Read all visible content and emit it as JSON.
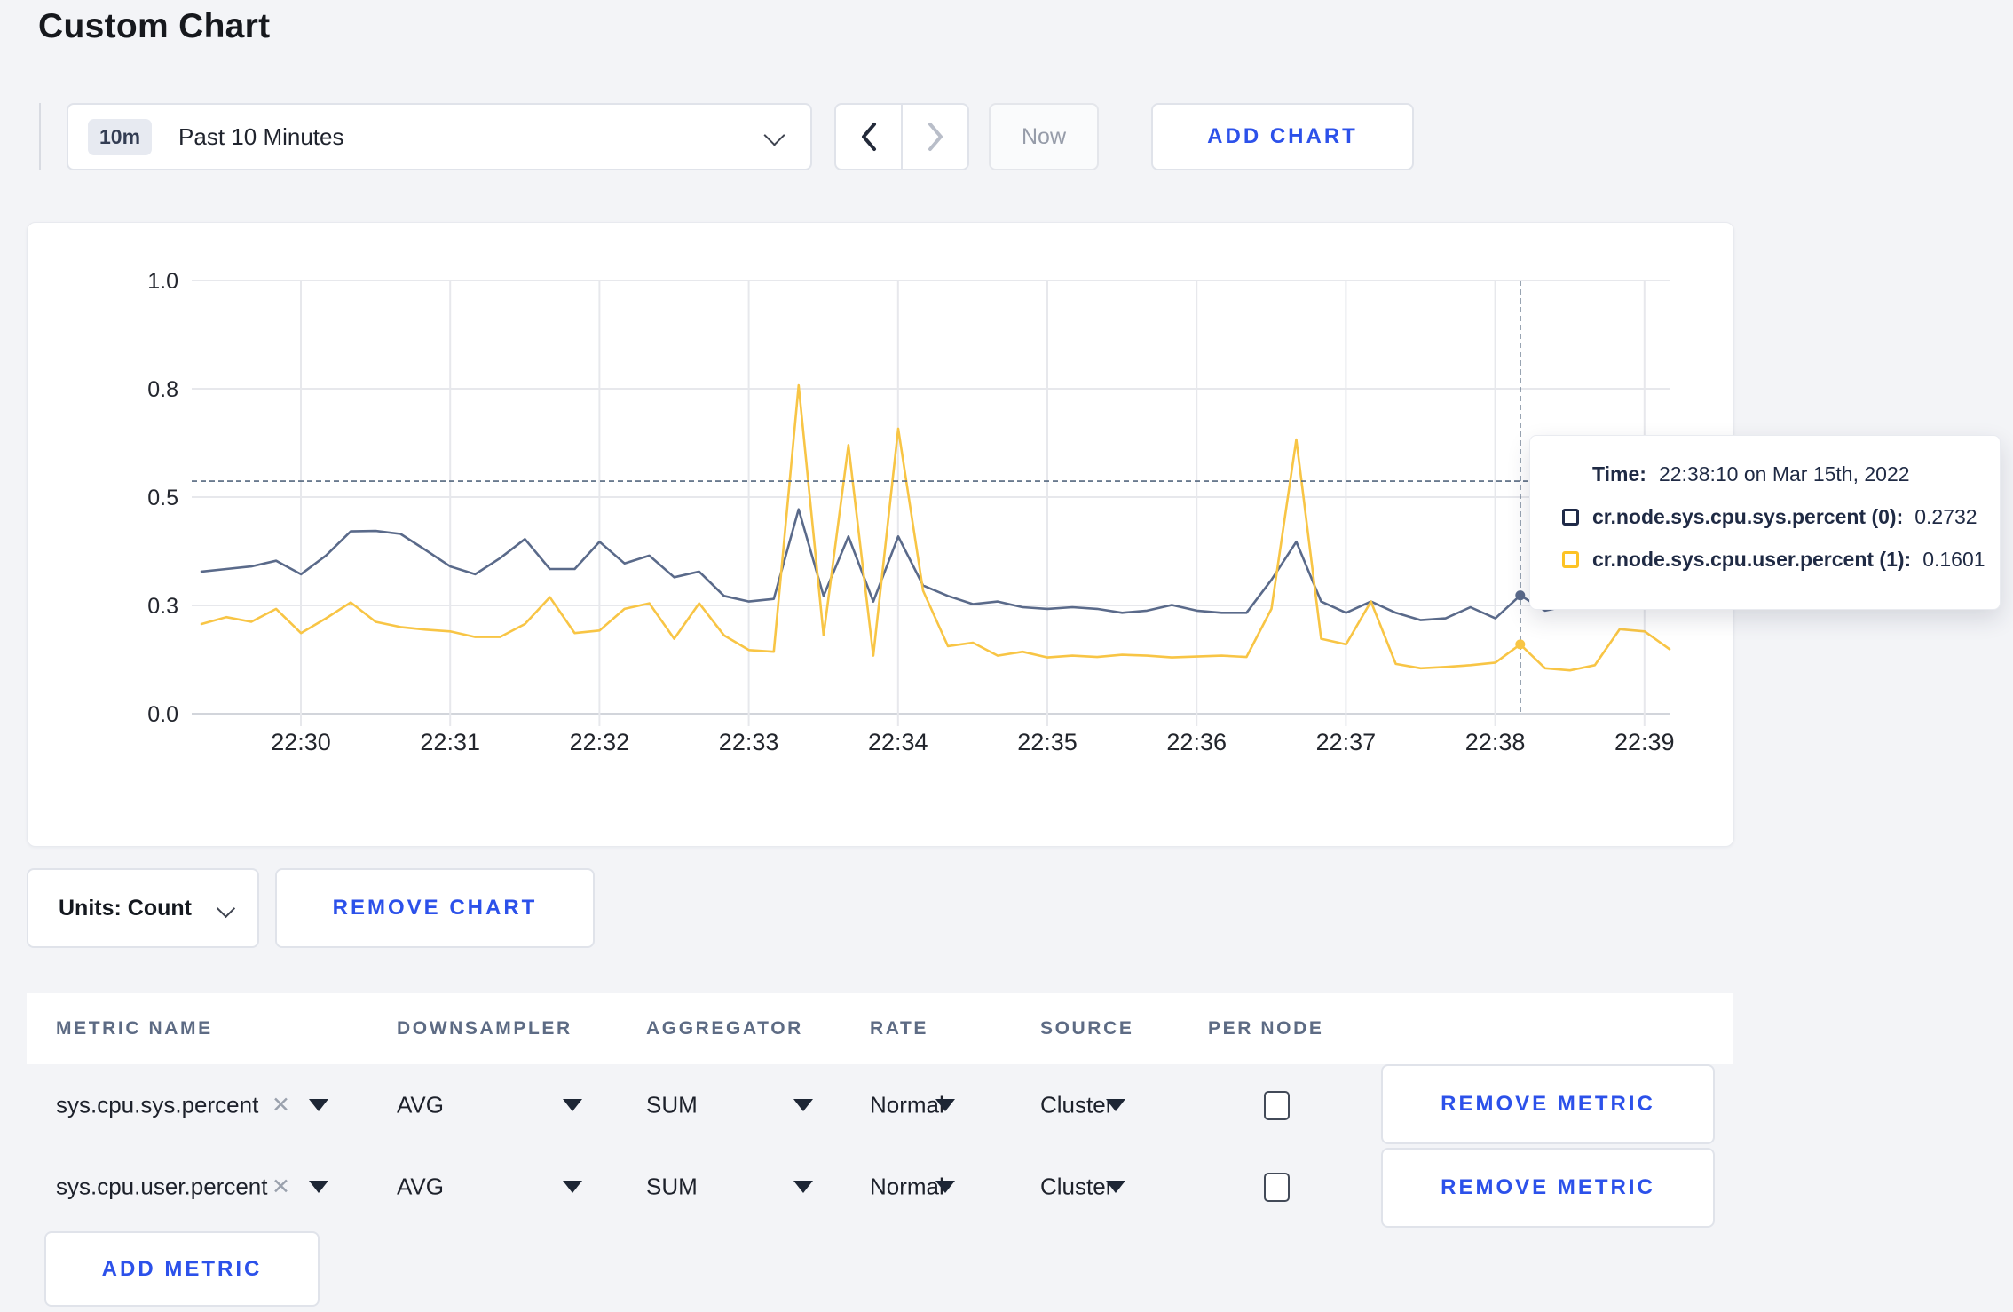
{
  "page": {
    "title": "Custom Chart",
    "background": "#f3f4f7",
    "accent_blue": "#2c51ea"
  },
  "toolbar": {
    "time_badge": "10m",
    "time_label": "Past 10 Minutes",
    "prev_icon": "chevron-left",
    "next_icon": "chevron-right",
    "now_label": "Now",
    "add_chart_label": "ADD CHART"
  },
  "chart_data": {
    "type": "line",
    "title": "",
    "xlabel": "",
    "ylabel": "",
    "ylim": [
      0,
      1
    ],
    "grid": true,
    "start_time": "22:29:20",
    "interval_seconds": 10,
    "xticks": [
      "22:30",
      "22:31",
      "22:32",
      "22:33",
      "22:34",
      "22:35",
      "22:36",
      "22:37",
      "22:38",
      "22:39"
    ],
    "yticks": [
      {
        "v": 0,
        "label": "0.0"
      },
      {
        "v": 0.25,
        "label": "0.3"
      },
      {
        "v": 0.5,
        "label": "0.5"
      },
      {
        "v": 0.75,
        "label": "0.8"
      },
      {
        "v": 1,
        "label": "1.0"
      }
    ],
    "series": [
      {
        "name": "cr.node.sys.cpu.sys.percent",
        "color": "#5a6a8a",
        "values": [
          0.328,
          0.334,
          0.34,
          0.353,
          0.322,
          0.365,
          0.421,
          0.422,
          0.415,
          0.378,
          0.34,
          0.322,
          0.359,
          0.403,
          0.334,
          0.334,
          0.397,
          0.347,
          0.365,
          0.315,
          0.328,
          0.272,
          0.259,
          0.265,
          0.472,
          0.272,
          0.409,
          0.259,
          0.409,
          0.296,
          0.272,
          0.253,
          0.259,
          0.246,
          0.242,
          0.246,
          0.242,
          0.233,
          0.238,
          0.251,
          0.238,
          0.233,
          0.233,
          0.309,
          0.397,
          0.259,
          0.233,
          0.259,
          0.233,
          0.216,
          0.22,
          0.246,
          0.22,
          0.2732,
          0.238,
          0.25,
          0.262,
          0.272,
          0.28,
          0.285
        ]
      },
      {
        "name": "cr.node.sys.cpu.user.percent",
        "color": "#f8c545",
        "values": [
          0.207,
          0.223,
          0.212,
          0.242,
          0.186,
          0.22,
          0.257,
          0.212,
          0.2,
          0.194,
          0.19,
          0.177,
          0.177,
          0.207,
          0.269,
          0.186,
          0.192,
          0.242,
          0.255,
          0.173,
          0.255,
          0.181,
          0.147,
          0.143,
          0.758,
          0.181,
          0.62,
          0.134,
          0.658,
          0.284,
          0.156,
          0.164,
          0.134,
          0.143,
          0.13,
          0.134,
          0.131,
          0.136,
          0.134,
          0.13,
          0.132,
          0.134,
          0.131,
          0.242,
          0.633,
          0.173,
          0.16,
          0.259,
          0.115,
          0.105,
          0.108,
          0.112,
          0.118,
          0.1601,
          0.105,
          0.1,
          0.112,
          0.195,
          0.19,
          0.149
        ]
      }
    ],
    "crosshair": {
      "point_index": 53,
      "time": "22:38:10",
      "hline_value": 0.5367,
      "dash_color": "#54677e"
    }
  },
  "tooltip": {
    "time_label": "Time:",
    "time_value": "22:38:10 on Mar 15th, 2022",
    "rows": [
      {
        "name": "cr.node.sys.cpu.sys.percent (0):",
        "value": "0.2732",
        "color": "#1f2a48"
      },
      {
        "name": "cr.node.sys.cpu.user.percent (1):",
        "value": "0.1601",
        "color": "#fdc325"
      }
    ]
  },
  "footer": {
    "units_label": "Units: Count",
    "remove_chart_label": "REMOVE CHART"
  },
  "table": {
    "headers": [
      "METRIC NAME",
      "DOWNSAMPLER",
      "AGGREGATOR",
      "RATE",
      "SOURCE",
      "PER NODE"
    ],
    "rows": [
      {
        "metric": "sys.cpu.sys.percent",
        "downsampler": "AVG",
        "aggregator": "SUM",
        "rate": "Normal",
        "source": "Cluster",
        "per_node_checked": false,
        "remove_label": "REMOVE METRIC"
      },
      {
        "metric": "sys.cpu.user.percent",
        "downsampler": "AVG",
        "aggregator": "SUM",
        "rate": "Normal",
        "source": "Cluster",
        "per_node_checked": false,
        "remove_label": "REMOVE METRIC"
      }
    ],
    "add_metric_label": "ADD METRIC"
  }
}
